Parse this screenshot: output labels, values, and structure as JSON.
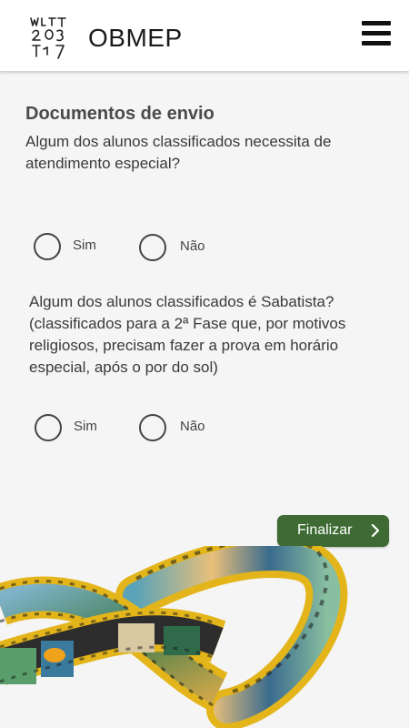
{
  "app": {
    "title": "OBMEP"
  },
  "section": {
    "title": "Documentos de envio"
  },
  "questions": [
    {
      "text": "Algum dos alunos classificados necessita de atendimento especial?",
      "options": [
        "Sim",
        "Não"
      ]
    },
    {
      "text": "Algum dos alunos classificados é Sabatista? (classificados para a 2ª Fase que, por motivos religiosos, precisam fazer a prova em horário especial, após o por do sol)",
      "options": [
        "Sim",
        "Não"
      ]
    }
  ],
  "actions": {
    "finalize_label": "Finalizar"
  },
  "icons": {
    "menu": "hamburger-menu-icon",
    "finalize": "chevron-right-icon",
    "logo": "obmep-logo"
  },
  "colors": {
    "primary_button": "#3e6b34",
    "film_strip": "#e3b51a",
    "background": "#f5f5f5"
  }
}
